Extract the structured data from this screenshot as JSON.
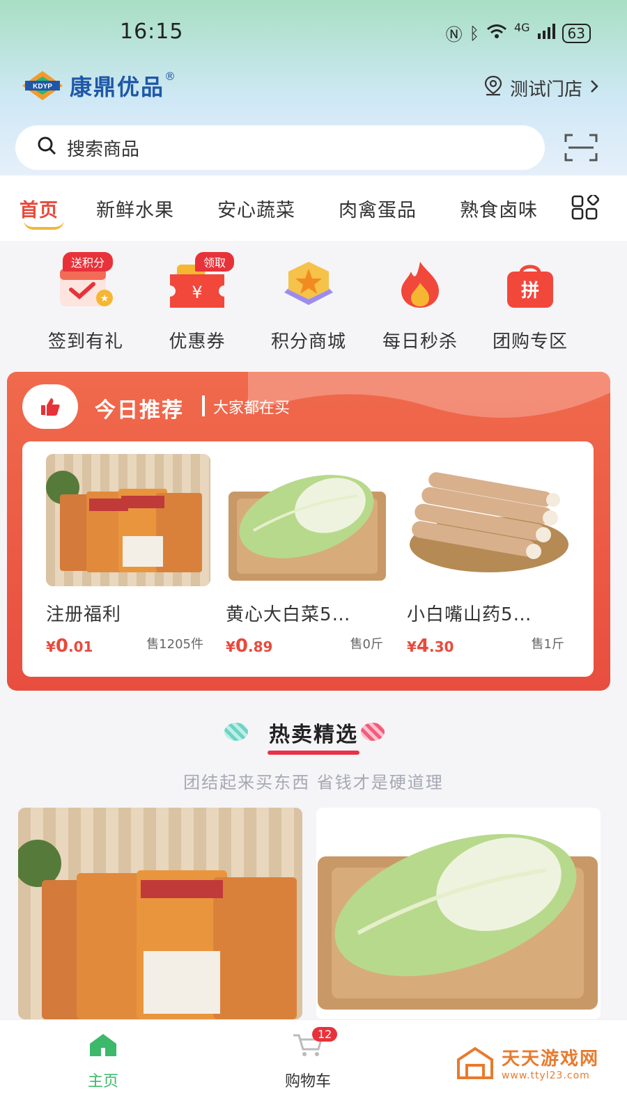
{
  "status_bar": {
    "time": "16:15",
    "network": "4G",
    "battery": "63"
  },
  "header": {
    "brand": "康鼎优品",
    "registered_mark": "®",
    "logo_letters": "KDYP",
    "store_name": "测试门店"
  },
  "search": {
    "placeholder": "搜索商品"
  },
  "categories": [
    "首页",
    "新鲜水果",
    "安心蔬菜",
    "肉禽蛋品",
    "熟食卤味"
  ],
  "quick_menu": [
    {
      "label": "签到有礼",
      "badge": "送积分"
    },
    {
      "label": "优惠券",
      "badge": "领取",
      "glyph": "¥"
    },
    {
      "label": "积分商城"
    },
    {
      "label": "每日秒杀"
    },
    {
      "label": "团购专区",
      "glyph": "拼"
    }
  ],
  "recommend": {
    "title": "今日推荐",
    "subtitle": "大家都在买",
    "products": [
      {
        "name": "注册福利",
        "price_symbol": "¥",
        "price_int": "0",
        "price_dec": ".01",
        "sold": "售1205件"
      },
      {
        "name": "黄心大白菜5…",
        "price_symbol": "¥",
        "price_int": "0",
        "price_dec": ".89",
        "sold": "售0斤"
      },
      {
        "name": "小白嘴山药5…",
        "price_symbol": "¥",
        "price_int": "4",
        "price_dec": ".30",
        "sold": "售1斤"
      }
    ]
  },
  "hot": {
    "title": "热卖精选",
    "subtitle": "团结起来买东西 省钱才是硬道理"
  },
  "bottom_nav": {
    "home": "主页",
    "cart": "购物车",
    "cart_count": "12"
  },
  "watermark": {
    "name": "天天游戏网",
    "url": "www.ttyl23.com"
  },
  "colors": {
    "accent": "#e84a3c",
    "brand_blue": "#1f57a8",
    "tab_underline": "#f0b73a",
    "home_green": "#3cb96a"
  }
}
